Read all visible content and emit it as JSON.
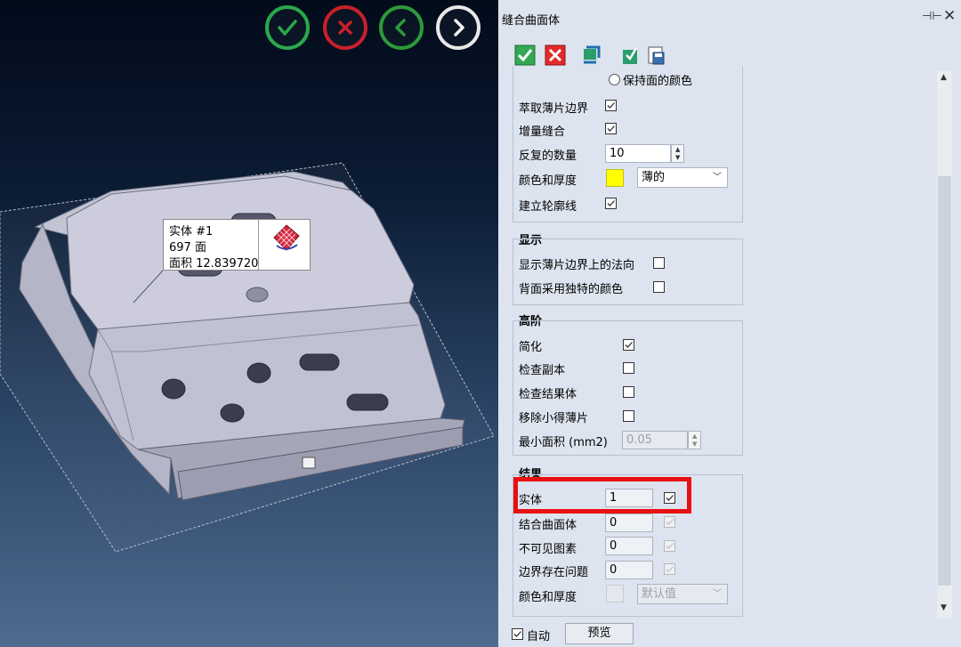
{
  "dialog": {
    "title": "缝合曲面体",
    "pin_label": "⊣⊢",
    "close_label": "✕"
  },
  "viewport": {
    "tooltip": {
      "line1": "实体 #1",
      "line2": "697 面",
      "line3": "面积 12.839720"
    },
    "buttons": [
      "ok",
      "cancel",
      "back",
      "forward"
    ]
  },
  "top_section": {
    "keep_face_color": "保持面的颜色",
    "extract_sheet_boundary": "萃取薄片边界",
    "incremental_stitch": "增量缝合",
    "iterations_label": "反复的数量",
    "iterations_value": "10",
    "color_thickness_label": "颜色和厚度",
    "thickness_value": "薄的",
    "color_value": "#ffff00",
    "create_outline": "建立轮廓线"
  },
  "display": {
    "title": "显示",
    "show_normals": "显示薄片边界上的法向",
    "backface_color": "背面采用独特的颜色"
  },
  "advanced": {
    "title": "高阶",
    "simplify": "简化",
    "check_duplicates": "检查副本",
    "check_result": "检查结果体",
    "remove_small": "移除小得薄片",
    "min_area_label": "最小面积 (mm2)",
    "min_area_value": "0.05"
  },
  "results": {
    "title": "结果",
    "solid_label": "实体",
    "solid_value": "1",
    "combined_label": "结合曲面体",
    "combined_value": "0",
    "invisible_label": "不可见图素",
    "invisible_value": "0",
    "boundary_label": "边界存在问题",
    "boundary_value": "0",
    "color_thickness_label": "颜色和厚度",
    "default_value": "默认值"
  },
  "footer": {
    "auto_label": "自动",
    "preview_label": "预览"
  },
  "colors": {
    "ok": "#2aa84a",
    "cancel": "#c8202a",
    "back": "#2d9a3a",
    "forward": "#e8e8e8",
    "highlight": "#e81010"
  }
}
